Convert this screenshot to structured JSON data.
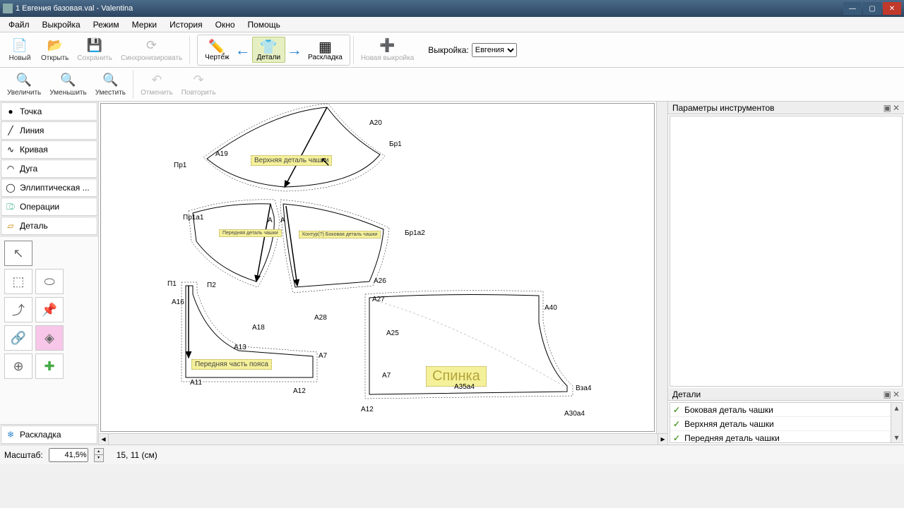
{
  "title": "1 Евгения базовая.val - Valentina",
  "menu": [
    "Файл",
    "Выкройка",
    "Режим",
    "Мерки",
    "История",
    "Окно",
    "Помощь"
  ],
  "toolbar1": {
    "new": "Новый",
    "open": "Открыть",
    "save": "Сохранить",
    "sync": "Синхронизировать"
  },
  "modes": {
    "draw": "Чертёж",
    "details": "Детали",
    "layout": "Раскладка"
  },
  "newpattern": "Новая выкройка",
  "pattern_label": "Выкройка:",
  "pattern_value": "Евгения",
  "toolbar2": {
    "zoomin": "Увеличить",
    "zoomout": "Уменьшить",
    "fit": "Уместить",
    "undo": "Отменить",
    "redo": "Повторить"
  },
  "tools": {
    "point": "Точка",
    "line": "Линия",
    "curve": "Кривая",
    "arc": "Дуга",
    "elliptic": "Эллиптическая ...",
    "operations": "Операции",
    "detail": "Деталь",
    "layout": "Раскладка"
  },
  "right": {
    "params_title": "Параметры инструментов",
    "details_title": "Детали",
    "detail_items": [
      "Боковая деталь чашки",
      "Верхняя деталь чашки",
      "Передняя деталь чашки"
    ]
  },
  "status": {
    "scale_label": "Масштаб:",
    "scale_value": "41,5%",
    "coords": "15, 11 (см)"
  },
  "labels": {
    "upper_cup": "Верхняя деталь чашки",
    "front_cup": "Передняя деталь чашки",
    "side_cup": "Контур(?) Боковая деталь чашки",
    "front_belt": "Передняя часть пояса",
    "back": "Спинка"
  },
  "points": {
    "A20": "A20",
    "Бр1": "Бр1",
    "A19": "A19",
    "Пр1": "Пр1",
    "Пр1a1": "Пр1a1",
    "A": "A",
    "A_": "A",
    "Бр1a2": "Бр1a2",
    "П1": "П1",
    "П2": "П2",
    "A16": "A16",
    "A18": "A18",
    "A28": "А28",
    "A26": "A26",
    "A13": "A13",
    "A7": "A7",
    "A11": "A11",
    "A12": "A12",
    "A25": "A25",
    "A7b": "A7",
    "A40": "A40",
    "Вза4": "Bза4",
    "A30a4": "A30a4",
    "A12b": "A12",
    "A27": "A27",
    "A35a4": "A35a4"
  }
}
